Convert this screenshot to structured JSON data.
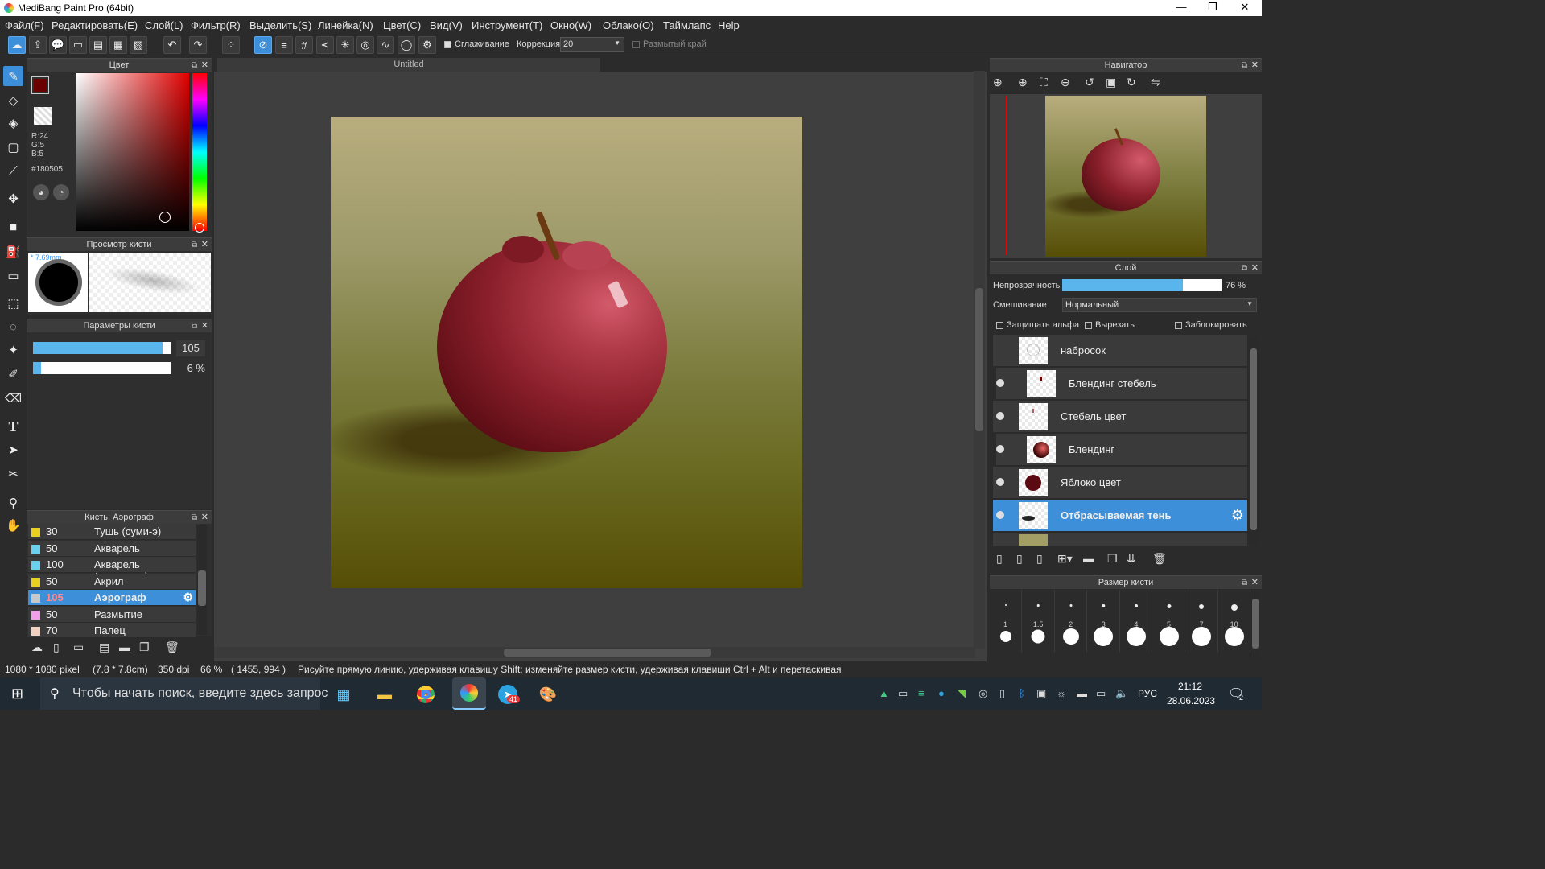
{
  "window": {
    "title": "MediBang Paint Pro (64bit)",
    "minimize": "—",
    "maximize": "❐",
    "close": "✕"
  },
  "menu": [
    "Файл(F)",
    "Редактировать(E)",
    "Слой(L)",
    "Фильтр(R)",
    "Выделить(S)",
    "Линейка(N)",
    "Цвет(C)",
    "Вид(V)",
    "Инструмент(T)",
    "Окно(W)",
    "Облако(O)",
    "Таймлапс",
    "Help"
  ],
  "toolbar": {
    "smoothing_label": "Сглаживание",
    "correction_label": "Коррекция",
    "correction_value": "20",
    "soft_edge_label": "Размытый край"
  },
  "color_panel": {
    "title": "Цвет",
    "r": "R:24",
    "g": "G:5",
    "b": "B:5",
    "hex": "#180505",
    "fg_color": "#180505"
  },
  "brush_preview": {
    "title": "Просмотр кисти",
    "size_label": "* 7.69mm"
  },
  "brush_params": {
    "title": "Параметры кисти",
    "size_value": "105",
    "opacity_value": "6 %",
    "size_fraction": 0.94,
    "opacity_fraction": 0.06
  },
  "brush_list": {
    "title": "Кисть: Аэрограф",
    "items": [
      {
        "num": "30",
        "name": "Тушь (суми-э)",
        "color": "#e8d020"
      },
      {
        "num": "50",
        "name": "Акварель",
        "color": "#6ad0f0"
      },
      {
        "num": "100",
        "name": "Акварель (размытая)",
        "color": "#6ad0f0"
      },
      {
        "num": "50",
        "name": "Акрил",
        "color": "#e8d020"
      },
      {
        "num": "105",
        "name": "Аэрограф",
        "color": "#c8c8c8"
      },
      {
        "num": "50",
        "name": "Размытие",
        "color": "#f0a0e8"
      },
      {
        "num": "70",
        "name": "Палец",
        "color": "#f0d0c0"
      }
    ]
  },
  "document": {
    "tab": "Untitled"
  },
  "navigator": {
    "title": "Навигатор"
  },
  "layers_panel": {
    "title": "Слой",
    "opacity_label": "Непрозрачность",
    "opacity_value": "76 %",
    "opacity_fraction": 0.76,
    "blend_label": "Смешивание",
    "blend_value": "Нормальный",
    "protect_alpha": "Защищать альфа",
    "clip": "Вырезать",
    "lock": "Заблокировать",
    "layers": [
      {
        "name": "набросок",
        "visible": false,
        "indent": false,
        "selected": false
      },
      {
        "name": "Блендинг стебель",
        "visible": true,
        "indent": true,
        "selected": false
      },
      {
        "name": "Стебель цвет",
        "visible": true,
        "indent": false,
        "selected": false
      },
      {
        "name": "Блендинг",
        "visible": true,
        "indent": true,
        "selected": false
      },
      {
        "name": "Яблоко цвет",
        "visible": true,
        "indent": false,
        "selected": false
      },
      {
        "name": "Отбрасываемая тень",
        "visible": true,
        "indent": false,
        "selected": true
      }
    ]
  },
  "brush_size_panel": {
    "title": "Размер кисти",
    "sizes": [
      "1",
      "1.5",
      "2",
      "3",
      "4",
      "5",
      "7",
      "10"
    ]
  },
  "status": {
    "dimensions": "1080 * 1080 pixel",
    "cm": "(7.8 * 7.8cm)",
    "dpi": "350 dpi",
    "zoom": "66 %",
    "coords": "( 1455, 994 )",
    "hint": "Рисуйте прямую линию, удерживая клавишу Shift; изменяйте размер кисти, удерживая клавиши Ctrl + Alt и перетаскивая"
  },
  "taskbar": {
    "search_placeholder": "Чтобы начать поиск, введите здесь запрос",
    "lang": "РУС",
    "time": "21:12",
    "date": "28.06.2023",
    "telegram_badge": "41",
    "notif": "2"
  }
}
